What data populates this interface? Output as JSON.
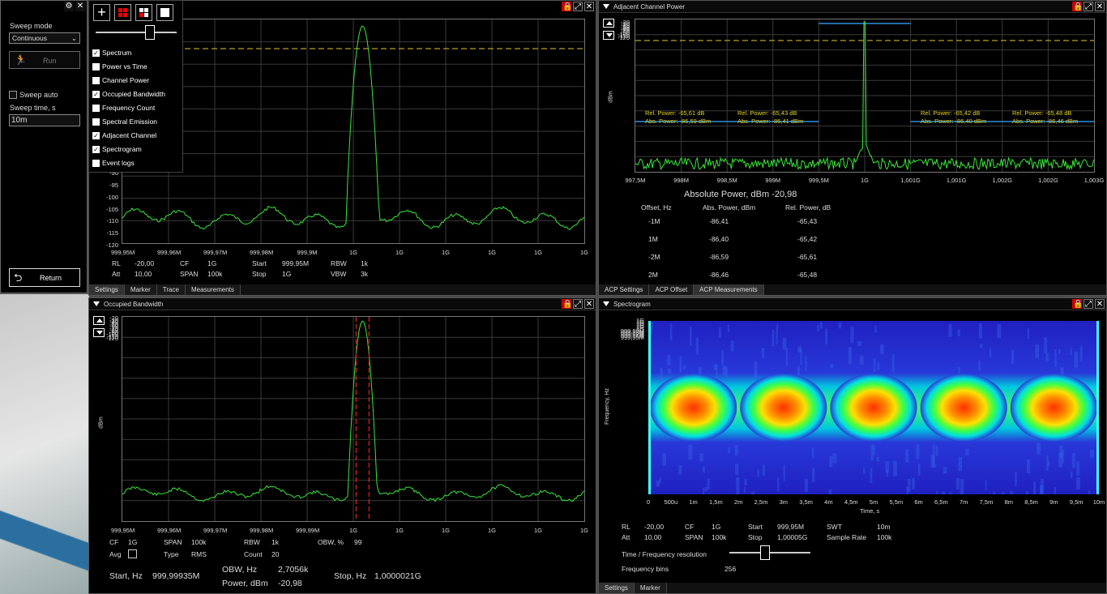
{
  "sweep": {
    "title": "Sweep mode",
    "mode": "Continuous",
    "run": "Run",
    "auto": "Sweep auto",
    "time_label": "Sweep time, s",
    "time_value": "10m",
    "return": "Return"
  },
  "menu": {
    "items": [
      {
        "label": "Spectrum",
        "checked": true
      },
      {
        "label": "Power vs Time",
        "checked": false
      },
      {
        "label": "Channel Power",
        "checked": false
      },
      {
        "label": "Occupied Bandwidth",
        "checked": true
      },
      {
        "label": "Frequency Count",
        "checked": false
      },
      {
        "label": "Spectral Emission",
        "checked": false
      },
      {
        "label": "Adjacent Channel",
        "checked": true
      },
      {
        "label": "Spectrogram",
        "checked": true
      },
      {
        "label": "Event logs",
        "checked": false
      }
    ]
  },
  "spectrum": {
    "yticks": [
      "-90",
      "-95",
      "-100",
      "-105",
      "-110",
      "-115",
      "-120"
    ],
    "xticks": [
      "999,95M",
      "999,96M",
      "999,97M",
      "999,98M",
      "999,9M",
      "1G",
      "1G",
      "1G",
      "1G",
      "1G",
      "1G"
    ],
    "params": {
      "rl_l": "RL",
      "rl_v": "-20,00",
      "att_l": "Att",
      "att_v": "10,00",
      "cf_l": "CF",
      "cf_v": "1G",
      "span_l": "SPAN",
      "span_v": "100k",
      "start_l": "Start",
      "start_v": "999,95M",
      "stop_l": "Stop",
      "stop_v": "1G",
      "rbw_l": "RBW",
      "rbw_v": "1k",
      "vbw_l": "VBW",
      "vbw_v": "3k"
    },
    "tabs": [
      "Settings",
      "Marker",
      "Trace",
      "Measurements"
    ]
  },
  "acp": {
    "title": "Adjacent Channel Power",
    "yticks": [
      "-20",
      "-30",
      "-40",
      "-50",
      "-60",
      "-70",
      "-80",
      "-90",
      "-100",
      "-110",
      "-120"
    ],
    "ylabel": "dBm",
    "xticks": [
      "997,5M",
      "998M",
      "998,5M",
      "999M",
      "999,5M",
      "1G",
      "1,001G",
      "1,001G",
      "1,002G",
      "1,002G",
      "1,003G"
    ],
    "annotations": [
      {
        "rel": "Rel. Power: -65,61 dB",
        "abs": "Abs. Power: -86,59 dBm"
      },
      {
        "rel": "Rel. Power: -65,43 dB",
        "abs": "Abs. Power: -86,41 dBm"
      },
      {
        "rel": "Rel. Power: -65,42 dB",
        "abs": "Abs. Power: -86,40 dBm"
      },
      {
        "rel": "Rel. Power: -65,48 dB",
        "abs": "Abs. Power: -86,46 dBm"
      }
    ],
    "abs_power": "Absolute Power, dBm  -20,98",
    "table": {
      "headers": [
        "Offset, Hz",
        "Abs. Power, dBm",
        "Rel. Power, dB"
      ],
      "rows": [
        [
          "-1M",
          "-86,41",
          "-65,43"
        ],
        [
          "1M",
          "-86,40",
          "-65,42"
        ],
        [
          "-2M",
          "-86,59",
          "-65,61"
        ],
        [
          "2M",
          "-86,46",
          "-65,48"
        ]
      ]
    },
    "tabs": [
      "ACP Settings",
      "ACP Offset",
      "ACP Measurements"
    ]
  },
  "obw": {
    "title": "Occupied Bandwidth",
    "yticks": [
      "-20",
      "-30",
      "-40",
      "-50",
      "-60",
      "-70",
      "-80",
      "-90",
      "-100",
      "-110",
      "-120"
    ],
    "ylabel": "dBm",
    "xticks": [
      "999,95M",
      "999,96M",
      "999,97M",
      "999,98M",
      "999,99M",
      "1G",
      "1G",
      "1G",
      "1G",
      "1G",
      "1G"
    ],
    "params": {
      "cf_l": "CF",
      "cf_v": "1G",
      "span_l": "SPAN",
      "span_v": "100k",
      "rbw_l": "RBW",
      "rbw_v": "1k",
      "obwp_l": "OBW, %",
      "obwp_v": "99",
      "avg_l": "Avg",
      "type_l": "Type",
      "type_v": "RMS",
      "count_l": "Count",
      "count_v": "20"
    },
    "res": {
      "start_l": "Start, Hz",
      "start_v": "999,99935M",
      "obw_l": "OBW, Hz",
      "obw_v": "2,7056k",
      "pow_l": "Power, dBm",
      "pow_v": "-20,98",
      "stop_l": "Stop, Hz",
      "stop_v": "1,0000021G"
    }
  },
  "spectrogram": {
    "title": "Spectrogram",
    "yticks": [
      "1G",
      "1G",
      "1G",
      "1G",
      "1G",
      "1G",
      "999,99M",
      "999,98M",
      "999,97M",
      "999,96M",
      "999,95M"
    ],
    "ylabel": "Frequency, Hz",
    "xticks": [
      "0",
      "500u",
      "1m",
      "1,5m",
      "2m",
      "2,5m",
      "3m",
      "3,5m",
      "4m",
      "4,5m",
      "5m",
      "5,5m",
      "6m",
      "6,5m",
      "7m",
      "7,5m",
      "8m",
      "8,5m",
      "9m",
      "9,5m",
      "10m"
    ],
    "xlabel": "Time, s",
    "params": {
      "rl_l": "RL",
      "rl_v": "-20,00",
      "att_l": "Att",
      "att_v": "10,00",
      "cf_l": "CF",
      "cf_v": "1G",
      "span_l": "SPAN",
      "span_v": "100k",
      "start_l": "Start",
      "start_v": "999,95M",
      "stop_l": "Stop",
      "stop_v": "1,00005G",
      "swt_l": "SWT",
      "swt_v": "10m",
      "sr_l": "Sample Rate",
      "sr_v": "100k"
    },
    "tfr": "Time / Frequency resolution",
    "bins_l": "Frequency bins",
    "bins_v": "256",
    "tabs": [
      "Settings",
      "Marker"
    ]
  },
  "colors": {
    "trace": "#39e639",
    "limit": "#b8a020",
    "channel": "#2d8fe0",
    "obw_marker": "#e02020"
  }
}
